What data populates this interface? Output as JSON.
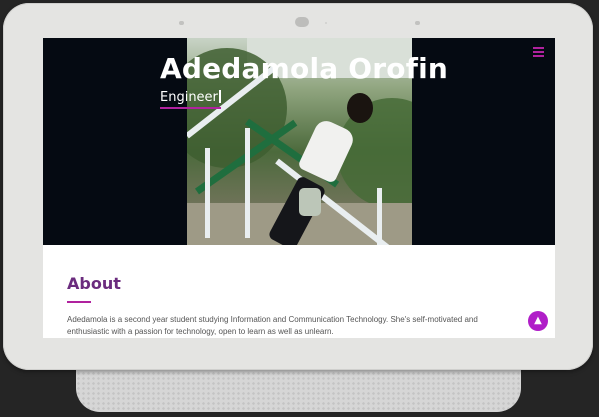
{
  "hero": {
    "name": "Adedamola Orofin",
    "role": "Engineer"
  },
  "about": {
    "heading": "About",
    "text": "Adedamola is a second year student studying Information and Communication Technology. She's self-motivated and enthusiastic with a passion for technology, open to learn as well as unlearn."
  },
  "icons": {
    "menu": "hamburger-menu-icon",
    "scroll_top": "chevron-up-icon"
  },
  "colors": {
    "accent": "#b0229e",
    "heading": "#6b2c7e",
    "hero_bg": "#050a12",
    "scroll_button": "#b01ec8"
  }
}
